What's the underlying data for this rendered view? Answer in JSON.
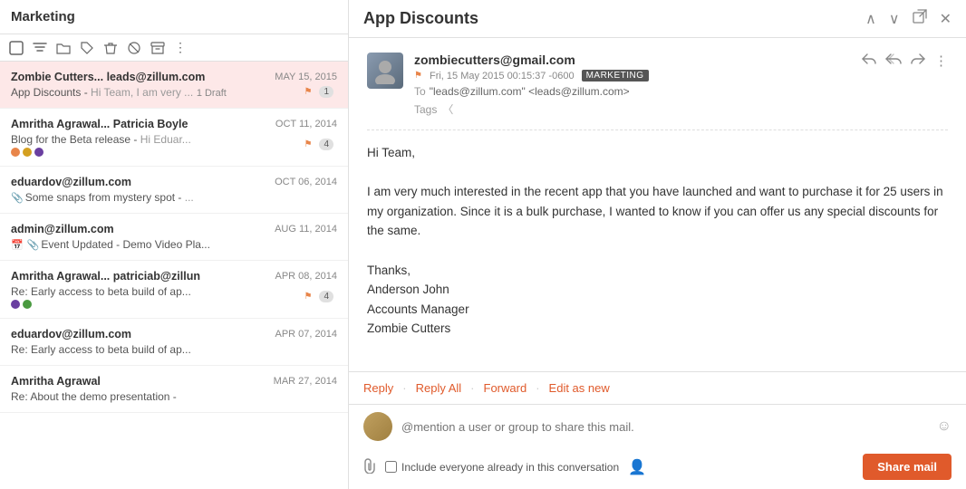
{
  "left": {
    "title": "Marketing",
    "toolbar": {
      "icons": [
        "checkbox",
        "filter",
        "folder",
        "tag",
        "trash",
        "block",
        "archive",
        "more"
      ]
    },
    "emails": [
      {
        "from": "Zombie Cutters... leads@zillum.com",
        "date": "MAY 15, 2015",
        "subject": "App Discounts",
        "preview": "Hi Team, I am very ...",
        "selected": true,
        "flag": true,
        "count": "1",
        "draft": "1 Draft",
        "tags": [],
        "hasAttachment": false,
        "hasCalendar": false
      },
      {
        "from": "Amritha Agrawal... Patricia Boyle",
        "date": "OCT 11, 2014",
        "subject": "Blog for the Beta release",
        "preview": "Hi Eduar...",
        "selected": false,
        "flag": true,
        "count": "4",
        "draft": "",
        "tags": [
          "#e8854a",
          "#d4a020",
          "#6a3fa0"
        ],
        "hasAttachment": false,
        "hasCalendar": false
      },
      {
        "from": "eduardov@zillum.com",
        "date": "OCT 06, 2014",
        "subject": "Some snaps from mystery spot",
        "preview": "...",
        "selected": false,
        "flag": false,
        "count": "",
        "draft": "",
        "tags": [],
        "hasAttachment": true,
        "hasCalendar": false
      },
      {
        "from": "admin@zillum.com",
        "date": "AUG 11, 2014",
        "subject": "Event Updated - Demo Video Pla...",
        "preview": "",
        "selected": false,
        "flag": false,
        "count": "",
        "draft": "",
        "tags": [],
        "hasAttachment": true,
        "hasCalendar": true
      },
      {
        "from": "Amritha Agrawal... patriciab@zillun",
        "date": "APR 08, 2014",
        "subject": "Re: Early access to beta build of ap...",
        "preview": "",
        "selected": false,
        "flag": true,
        "count": "4",
        "draft": "",
        "tags": [
          "#6a3fa0",
          "#4a9a40"
        ],
        "hasAttachment": false,
        "hasCalendar": false
      },
      {
        "from": "eduardov@zillum.com",
        "date": "APR 07, 2014",
        "subject": "Re: Early access to beta build of ap...",
        "preview": "",
        "selected": false,
        "flag": false,
        "count": "",
        "draft": "",
        "tags": [],
        "hasAttachment": false,
        "hasCalendar": false
      },
      {
        "from": "Amritha Agrawal",
        "date": "MAR 27, 2014",
        "subject": "Re: About the demo presentation -",
        "preview": "",
        "selected": false,
        "flag": false,
        "count": "",
        "draft": "",
        "tags": [],
        "hasAttachment": false,
        "hasCalendar": false
      }
    ]
  },
  "right": {
    "title": "App Discounts",
    "email": {
      "sender": "zombiecutters@gmail.com",
      "date": "Fri, 15 May 2015 00:15:37 -0600",
      "badge": "MARKETING",
      "to": "\"leads@zillum.com\" <leads@zillum.com>",
      "tags_label": "Tags",
      "body_lines": [
        "Hi Team,",
        "",
        "I am very much interested in the recent app that you have launched and want to purchase it for 25 users in my organization. Since it is a bulk purchase, I wanted to know if you can offer us any special discounts for the same.",
        "",
        "Thanks,",
        "Anderson John",
        "Accounts Manager",
        "Zombie Cutters"
      ]
    },
    "actions": {
      "reply": "Reply",
      "reply_all": "Reply All",
      "forward": "Forward",
      "edit_as_new": "Edit as new"
    },
    "share": {
      "placeholder": "@mention a user or group to share this mail.",
      "checkbox_label": "Include everyone already in this conversation",
      "share_button": "Share mail"
    }
  }
}
